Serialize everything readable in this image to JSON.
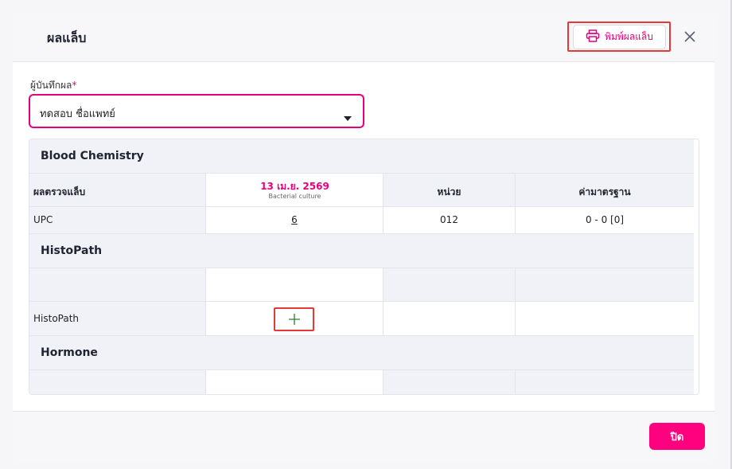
{
  "modal": {
    "title": "ผลแล็บ",
    "print_label": "พิมพ์ผลแล็บ",
    "close_icon": "close-icon",
    "print_icon": "printer-icon"
  },
  "recorder": {
    "label": "ผู้บันทึกผล",
    "required_mark": "*",
    "value": "ทดสอบ ชื่อแพทย์",
    "caret_icon": "caret-down-icon"
  },
  "table": {
    "sections": [
      {
        "title": "Blood Chemistry"
      },
      {
        "title": "HistoPath"
      },
      {
        "title": "Hormone"
      }
    ],
    "header": {
      "test_col": "ผลตรวจแล็บ",
      "date": "13 เม.ย. 2569",
      "date_sub": "Bacterial culture",
      "unit_col": "หน่วย",
      "ref_col": "ค่ามาตรฐาน"
    },
    "rows": [
      {
        "name": "UPC",
        "value": "6",
        "unit": "012",
        "ref": "0 - 0 [0]"
      },
      {
        "name": "HistoPath",
        "value": "",
        "unit": "",
        "ref": "",
        "add_icon": "plus-icon"
      }
    ]
  },
  "footer": {
    "close_label": "ปิด"
  },
  "colors": {
    "accent": "#e6007e",
    "button": "#ff007f",
    "highlight": "#e53935",
    "plus": "#2e7d32"
  }
}
